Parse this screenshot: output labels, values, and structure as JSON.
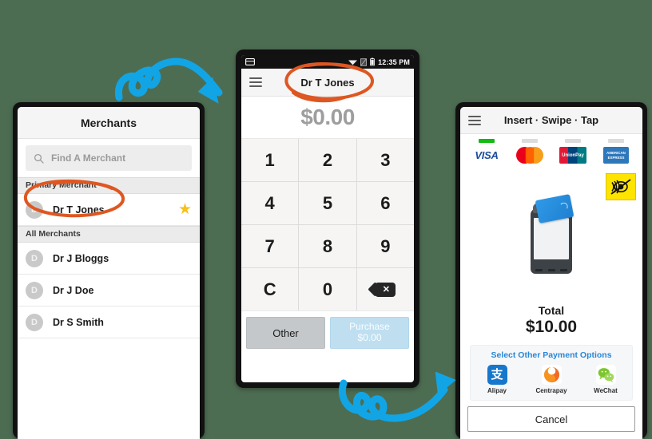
{
  "theme": {
    "background": "#4d6d52",
    "annotation_arrow_color": "#12a5e5",
    "annotation_circle_color": "#de5722",
    "accent_blue": "#2b86d4",
    "star_gold": "#f6c11a"
  },
  "merchants_phone": {
    "title": "Merchants",
    "search": {
      "placeholder": "Find A Merchant",
      "icon": "search-icon"
    },
    "sections": [
      {
        "label": "Primary Merchant",
        "rows": [
          {
            "avatar": "D",
            "name": "Dr T Jones",
            "starred": true,
            "star_icon": "star-icon"
          }
        ]
      },
      {
        "label": "All Merchants",
        "rows": [
          {
            "avatar": "D",
            "name": "Dr J Bloggs",
            "starred": false
          },
          {
            "avatar": "D",
            "name": "Dr J Doe",
            "starred": false
          },
          {
            "avatar": "D",
            "name": "Dr S Smith",
            "starred": false
          }
        ]
      }
    ]
  },
  "keypad_phone": {
    "statusbar": {
      "time": "12:35 PM",
      "left_icon": "card-reader-icon",
      "right_icons": [
        "wifi-icon",
        "signal-icon",
        "battery-icon"
      ]
    },
    "appbar": {
      "menu_icon": "hamburger-icon",
      "title": "Dr T Jones"
    },
    "amount": "$0.00",
    "keys": [
      "1",
      "2",
      "3",
      "4",
      "5",
      "6",
      "7",
      "8",
      "9",
      "C",
      "0",
      "⌫"
    ],
    "backspace_icon": "backspace-icon",
    "actions": {
      "other_label": "Other",
      "purchase_label": "Purchase",
      "purchase_amount": "$0.00"
    }
  },
  "payment_phone": {
    "appbar": {
      "menu_icon": "hamburger-icon",
      "title": "Insert · Swipe · Tap"
    },
    "card_brands": [
      {
        "name": "VISA",
        "indicator": "active"
      },
      {
        "name": "Mastercard",
        "indicator": "inactive"
      },
      {
        "name": "UnionPay",
        "indicator": "inactive"
      },
      {
        "name": "AMERICAN EXPRESS",
        "indicator": "inactive"
      }
    ],
    "terminal_icon": "payment-terminal-icon",
    "nfc_badge_icon": "contactless-disabled-icon",
    "total_label": "Total",
    "total_amount": "$10.00",
    "other_payment": {
      "title": "Select Other Payment Options",
      "wallets": [
        {
          "label": "Alipay",
          "icon": "alipay-icon"
        },
        {
          "label": "Centrapay",
          "icon": "centrapay-icon"
        },
        {
          "label": "WeChat",
          "icon": "wechat-icon"
        }
      ]
    },
    "cancel_label": "Cancel"
  },
  "annotations": [
    {
      "type": "arrow",
      "name": "arrow-to-keypad-phone"
    },
    {
      "type": "arrow",
      "name": "arrow-to-payment-phone"
    },
    {
      "type": "circle",
      "name": "highlight-merchant-row"
    },
    {
      "type": "circle",
      "name": "highlight-appbar-title"
    }
  ]
}
